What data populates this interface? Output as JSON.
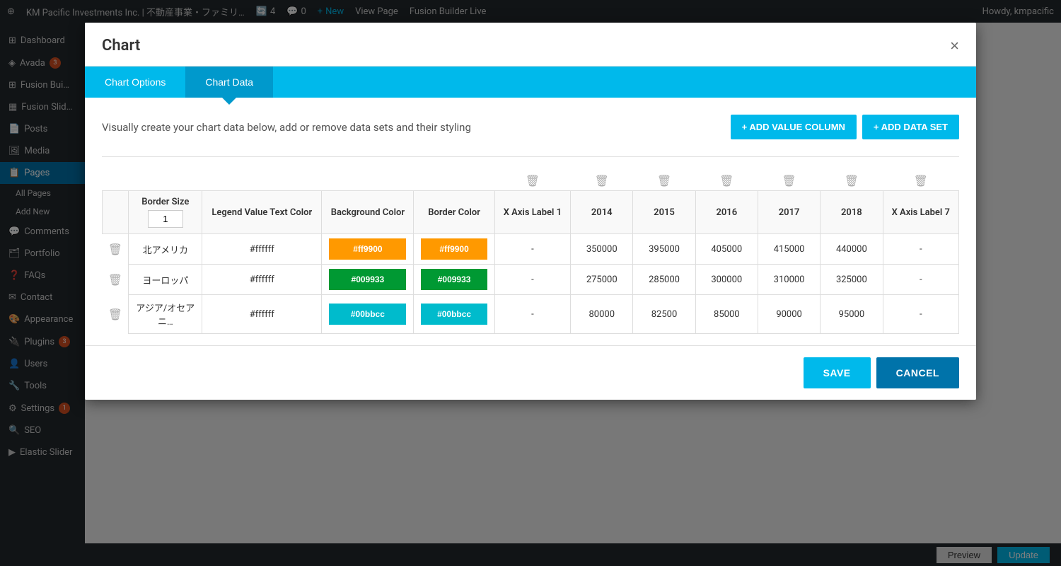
{
  "adminBar": {
    "logo": "⊕",
    "siteName": "KM Pacific Investments Inc. | 不動産事業・ファミリ…",
    "updates": "4",
    "comments": "0",
    "new": "New",
    "viewPage": "View Page",
    "fusionBuilderLive": "Fusion Builder Live",
    "howdy": "Howdy, kmpacific"
  },
  "sidebar": {
    "items": [
      {
        "label": "Dashboard"
      },
      {
        "label": "Avada",
        "badge": "3"
      },
      {
        "label": "Fusion Bui…"
      },
      {
        "label": "Fusion Slid…"
      },
      {
        "label": "Posts"
      },
      {
        "label": "Media"
      },
      {
        "label": "Pages",
        "active": true
      },
      {
        "label": "All Pages",
        "sub": true
      },
      {
        "label": "Add New",
        "sub": true
      },
      {
        "label": "Comments"
      },
      {
        "label": "Portfolio"
      },
      {
        "label": "FAQs"
      },
      {
        "label": "Contact"
      },
      {
        "label": "Appearance"
      },
      {
        "label": "Plugins",
        "badge": "3"
      },
      {
        "label": "Users"
      },
      {
        "label": "Tools"
      },
      {
        "label": "Settings",
        "badge": "1"
      },
      {
        "label": "SEO"
      },
      {
        "label": "Elastic Slider"
      }
    ]
  },
  "modal": {
    "title": "Chart",
    "closeLabel": "×",
    "tabs": [
      {
        "id": "chart-options",
        "label": "Chart Options",
        "active": false
      },
      {
        "id": "chart-data",
        "label": "Chart Data",
        "active": true
      }
    ],
    "description": "Visually create your chart data below, add or remove data sets and their styling",
    "addValueColumnLabel": "+ ADD VALUE COLUMN",
    "addDataSetLabel": "+ ADD DATA SET",
    "table": {
      "headers": {
        "borderSize": "Border Size",
        "borderSizeValue": "1",
        "legendValueTextColor": "Legend Value Text Color",
        "backgroundColor": "Background Color",
        "borderColor": "Border Color",
        "xAxisLabel1": "X Axis Label 1",
        "col2014": "2014",
        "col2015": "2015",
        "col2016": "2016",
        "col2017": "2017",
        "col2018": "2018",
        "xAxisLabel7": "X Axis Label 7"
      },
      "rows": [
        {
          "label": "北アメリカ",
          "legendTextColor": "#ffffff",
          "bgColor": "#ff9900",
          "borderColor": "#ff9900",
          "xAxisLabel": "-",
          "v2014": "350000",
          "v2015": "395000",
          "v2016": "405000",
          "v2017": "415000",
          "v2018": "440000",
          "xAxisLabel7": "-"
        },
        {
          "label": "ヨーロッパ",
          "legendTextColor": "#ffffff",
          "bgColor": "#009933",
          "borderColor": "#009933",
          "xAxisLabel": "-",
          "v2014": "275000",
          "v2015": "285000",
          "v2016": "300000",
          "v2017": "310000",
          "v2018": "325000",
          "xAxisLabel7": "-"
        },
        {
          "label": "アジア/オセアニ…",
          "legendTextColor": "#ffffff",
          "bgColor": "#00bbcc",
          "borderColor": "#00bbcc",
          "xAxisLabel": "-",
          "v2014": "80000",
          "v2015": "82500",
          "v2016": "85000",
          "v2017": "90000",
          "v2018": "95000",
          "xAxisLabel7": "-"
        }
      ]
    },
    "footer": {
      "saveLabel": "SAVE",
      "cancelLabel": "CANCEL"
    }
  },
  "bottomBar": {
    "previewLabel": "Preview",
    "updateLabel": "Update"
  }
}
